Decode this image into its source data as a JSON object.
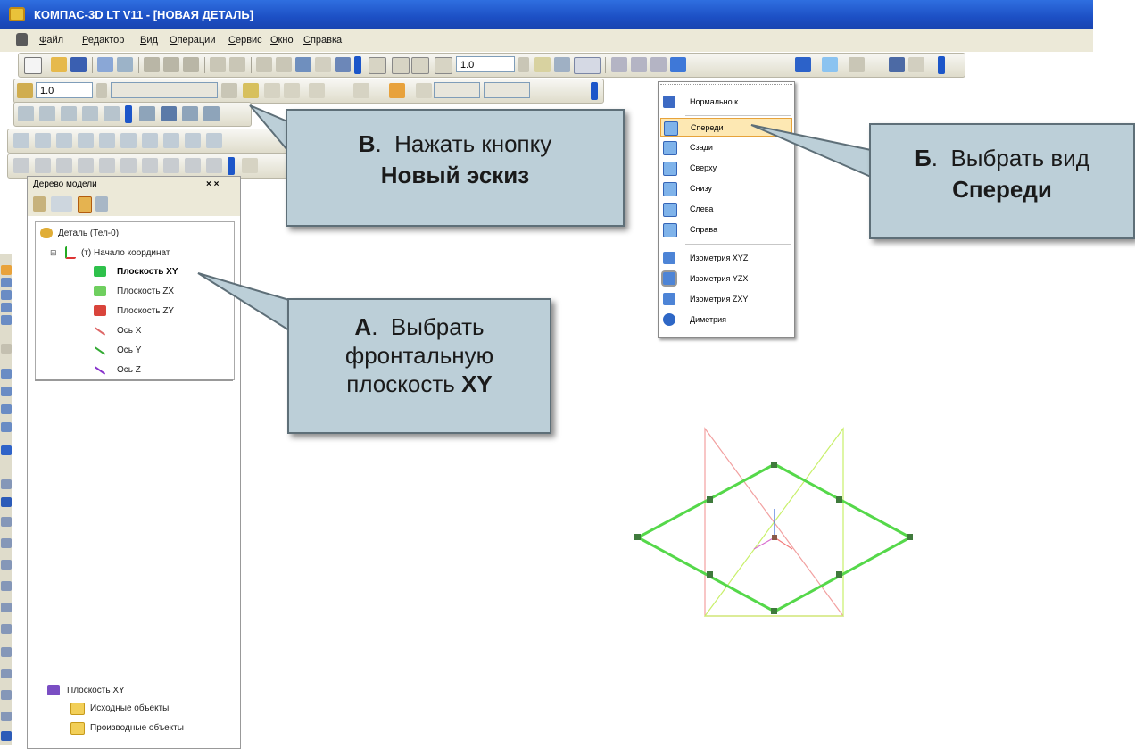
{
  "window": {
    "title": "КОМПАС-3D LT V11 - [НОВАЯ ДЕТАЛЬ]"
  },
  "menu": [
    "Файл",
    "Редактор",
    "Вид",
    "Операции",
    "Сервис",
    "Окно",
    "Справка"
  ],
  "toolbar": {
    "zoom_value": "1.0",
    "step_value": "1.0"
  },
  "model_tree": {
    "title": "Дерево модели",
    "close": "× ×",
    "nodes": [
      {
        "label": "Деталь (Тел-0)",
        "bold": false
      },
      {
        "label": "(т) Начало координат",
        "bold": false
      },
      {
        "label": "Плоскость XY",
        "bold": true
      },
      {
        "label": "Плоскость ZX",
        "bold": false
      },
      {
        "label": "Плоскость ZY",
        "bold": false
      },
      {
        "label": "Ось X",
        "bold": false
      },
      {
        "label": "Ось Y",
        "bold": false
      },
      {
        "label": "Ось Z",
        "bold": false
      }
    ],
    "bottom": {
      "title": "Плоскость XY",
      "items": [
        "Исходные объекты",
        "Производные объекты"
      ]
    }
  },
  "view_menu": {
    "items": [
      "Нормально к...",
      "Спереди",
      "Сзади",
      "Сверху",
      "Снизу",
      "Слева",
      "Справа",
      "Изометрия XYZ",
      "Изометрия YZX",
      "Изометрия ZXY",
      "Диметрия"
    ],
    "selected": "Спереди"
  },
  "callouts": {
    "a": {
      "letter": "А",
      "line1": "Выбрать",
      "line2": "фронтальную",
      "line3": "плоскость",
      "bold": "XY"
    },
    "b": {
      "letter": "Б",
      "line1": "Выбрать вид",
      "bold": "Спереди"
    },
    "v": {
      "letter": "В",
      "line1": "Нажать кнопку",
      "bold": "Новый эскиз"
    }
  },
  "colors": {
    "titlebar": "#1c4fc4",
    "callout_bg": "#bccfd8",
    "sketch_green": "#55d84a"
  }
}
